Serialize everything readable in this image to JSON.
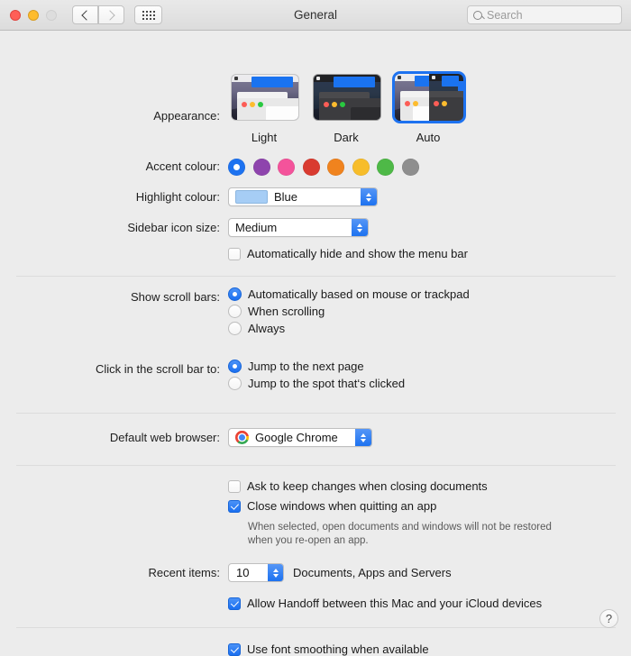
{
  "window": {
    "title": "General",
    "traffic_lights": [
      "close",
      "minimize",
      "zoom"
    ],
    "back_label": "Back",
    "forward_label": "Forward",
    "grid_label": "Show All",
    "search_placeholder": "Search"
  },
  "appearance": {
    "label": "Appearance:",
    "options": [
      {
        "id": "light",
        "caption": "Light",
        "selected": false
      },
      {
        "id": "dark",
        "caption": "Dark",
        "selected": false
      },
      {
        "id": "auto",
        "caption": "Auto",
        "selected": true
      }
    ]
  },
  "accent_colour": {
    "label": "Accent colour:",
    "selected_index": 0,
    "swatches": [
      {
        "name": "blue",
        "hex": "#1d72f0"
      },
      {
        "name": "purple",
        "hex": "#8e44ad"
      },
      {
        "name": "pink",
        "hex": "#f4539b"
      },
      {
        "name": "red",
        "hex": "#d93b30"
      },
      {
        "name": "orange",
        "hex": "#f0831e"
      },
      {
        "name": "yellow",
        "hex": "#f7bd2a"
      },
      {
        "name": "green",
        "hex": "#4eb947"
      },
      {
        "name": "graphite",
        "hex": "#8e8e8e"
      }
    ]
  },
  "highlight_colour": {
    "label": "Highlight colour:",
    "value": "Blue",
    "swatch_hex": "#a6cdf5"
  },
  "sidebar_icon_size": {
    "label": "Sidebar icon size:",
    "value": "Medium"
  },
  "auto_hide_menu_bar": {
    "label": "Automatically hide and show the menu bar",
    "checked": false
  },
  "show_scroll_bars": {
    "label": "Show scroll bars:",
    "options": [
      {
        "label": "Automatically based on mouse or trackpad",
        "selected": true
      },
      {
        "label": "When scrolling",
        "selected": false
      },
      {
        "label": "Always",
        "selected": false
      }
    ]
  },
  "click_scroll_bar": {
    "label": "Click in the scroll bar to:",
    "options": [
      {
        "label": "Jump to the next page",
        "selected": true
      },
      {
        "label": "Jump to the spot that‘s clicked",
        "selected": false
      }
    ]
  },
  "default_web_browser": {
    "label": "Default web browser:",
    "value": "Google Chrome",
    "icon": "chrome-icon"
  },
  "documents": {
    "ask_to_keep_changes": {
      "label": "Ask to keep changes when closing documents",
      "checked": false
    },
    "close_windows_quitting": {
      "label": "Close windows when quitting an app",
      "checked": true
    },
    "hint_line_1": "When selected, open documents and windows will not be restored",
    "hint_line_2": "when you re-open an app."
  },
  "recent_items": {
    "label": "Recent items:",
    "value": "10",
    "suffix": "Documents, Apps and Servers"
  },
  "handoff": {
    "label": "Allow Handoff between this Mac and your iCloud devices",
    "checked": true
  },
  "font_smoothing": {
    "label": "Use font smoothing when available",
    "checked": true
  },
  "help_button": {
    "label": "?"
  }
}
